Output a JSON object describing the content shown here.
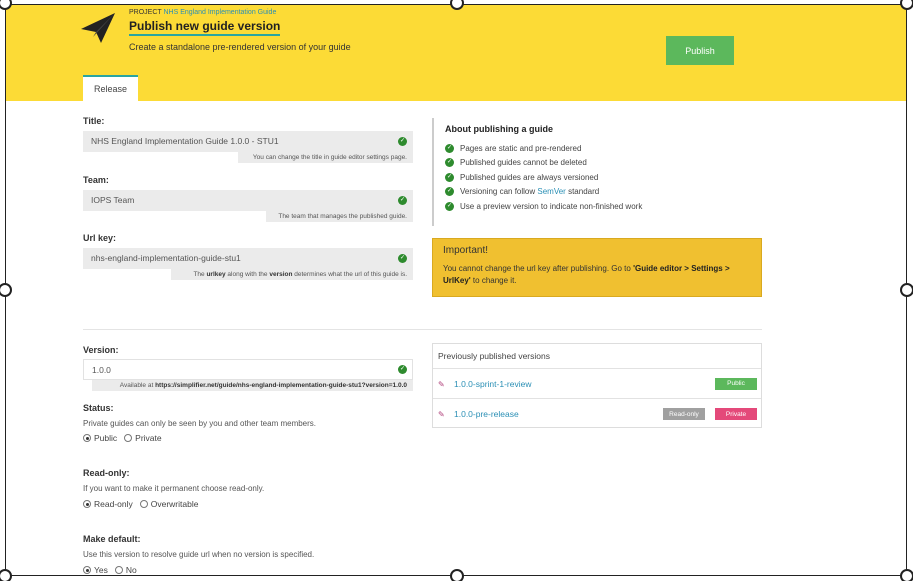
{
  "header": {
    "project_prefix": "PROJECT",
    "project_name": "NHS England Implementation Guide",
    "title": "Publish new guide version",
    "subtitle": "Create a standalone pre-rendered version of your guide",
    "publish_label": "Publish"
  },
  "tabs": {
    "release": "Release"
  },
  "form": {
    "title_label": "Title:",
    "title_value": "NHS England Implementation Guide 1.0.0 - STU1",
    "title_hint": "You can change the title in guide editor settings page.",
    "team_label": "Team:",
    "team_value": "IOPS Team",
    "team_hint": "The team that manages the published guide.",
    "url_label": "Url key:",
    "url_value": "nhs-england-implementation-guide-stu1",
    "url_hint_1": "The ",
    "url_hint_b1": "urlkey",
    "url_hint_2": " along with the ",
    "url_hint_b2": "version",
    "url_hint_3": " determines what the url of this guide is.",
    "version_label": "Version:",
    "version_value": "1.0.0",
    "version_hint_prefix": "Available at ",
    "version_hint_url": "https://simplifier.net/guide/nhs-england-implementation-guide-stu1?version=1.0.0",
    "status_label": "Status:",
    "status_help": "Private guides can only be seen by you and other team members.",
    "status_public": "Public",
    "status_private": "Private",
    "readonly_label": "Read-only:",
    "readonly_help": "If you want to make it permanent choose read-only.",
    "readonly_opt": "Read-only",
    "overwritable_opt": "Overwritable",
    "default_label": "Make default:",
    "default_help": "Use this version to resolve guide url when no version is specified.",
    "default_yes": "Yes",
    "default_no": "No"
  },
  "about": {
    "title": "About publishing a guide",
    "item1": "Pages are static and pre-rendered",
    "item2": "Published guides cannot be deleted",
    "item3": "Published guides are always versioned",
    "item4_a": "Versioning can follow ",
    "item4_link": "SemVer",
    "item4_b": " standard",
    "item5": "Use a preview version to indicate non-finished work"
  },
  "important": {
    "title": "Important!",
    "text_1": "You cannot change the url key after publishing. Go to ",
    "text_b": "'Guide editor > Settings > UrlKey'",
    "text_2": " to change it."
  },
  "previous": {
    "title": "Previously published versions",
    "v1_name": "1.0.0-sprint-1-review",
    "v1_badge": "Public",
    "v2_name": "1.0.0-pre-release",
    "v2_badge_readonly": "Read-only",
    "v2_badge": "Private"
  },
  "colors": {
    "header_bg": "#fcdb36",
    "publish_btn": "#5cb85c",
    "important_bg": "#f0c030",
    "badge_public": "#5cb85c",
    "badge_private": "#e4497a",
    "badge_readonly": "#a0a0a0",
    "link": "#2a8fb5"
  },
  "icons": [
    "paper-plane-icon",
    "check-circle-icon",
    "document-icon"
  ]
}
